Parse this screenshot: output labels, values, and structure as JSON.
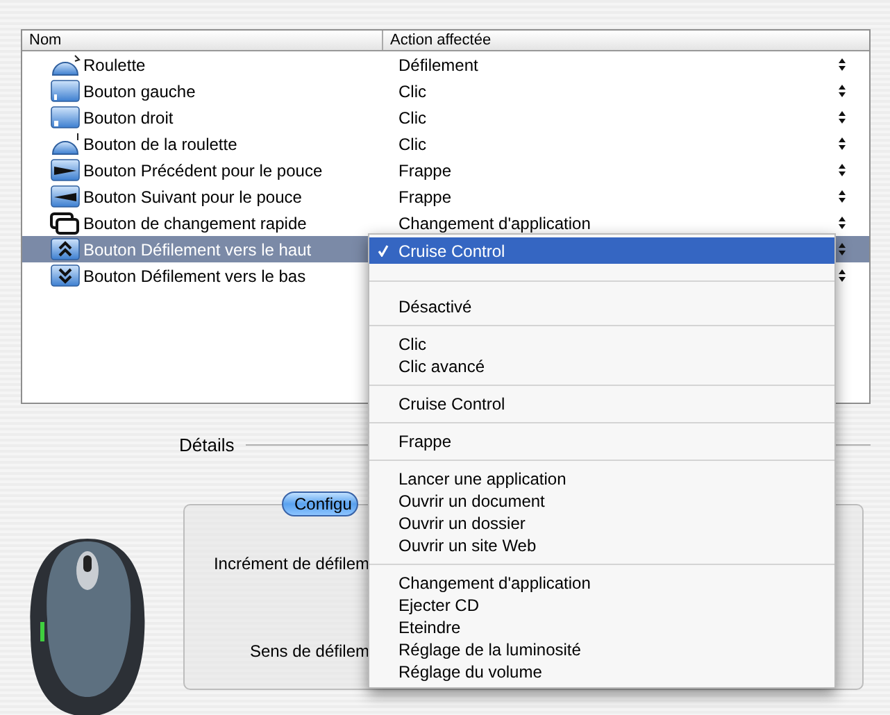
{
  "table": {
    "columns": [
      "Nom",
      "Action affectée"
    ],
    "rows": [
      {
        "kind": "wheel",
        "name": "Roulette",
        "action": "Défilement",
        "selected": false
      },
      {
        "kind": "button-left",
        "name": "Bouton gauche",
        "action": "Clic",
        "selected": false
      },
      {
        "kind": "button-right",
        "name": "Bouton droit",
        "action": "Clic",
        "selected": false
      },
      {
        "kind": "wheel-click",
        "name": "Bouton de la roulette",
        "action": "Clic",
        "selected": false
      },
      {
        "kind": "wedge-right",
        "name": "Bouton Précédent pour le pouce",
        "action": "Frappe",
        "selected": false
      },
      {
        "kind": "wedge-left",
        "name": "Bouton Suivant pour le pouce",
        "action": "Frappe",
        "selected": false
      },
      {
        "kind": "windows",
        "name": "Bouton de changement rapide",
        "action": "Changement d'application",
        "selected": false
      },
      {
        "kind": "chevrons-up",
        "name": "Bouton Défilement vers le haut",
        "selected": true
      },
      {
        "kind": "chevrons-down",
        "name": "Bouton Défilement vers le bas",
        "selected": false
      }
    ]
  },
  "menu": {
    "groups": [
      [
        {
          "label": "Cruise Control",
          "selected": true
        }
      ],
      [
        {
          "label": "Désactivé",
          "selected": false
        }
      ],
      [
        {
          "label": "Clic",
          "selected": false
        },
        {
          "label": "Clic avancé",
          "selected": false
        }
      ],
      [
        {
          "label": "Cruise Control",
          "selected": false
        }
      ],
      [
        {
          "label": "Frappe",
          "selected": false
        }
      ],
      [
        {
          "label": "Lancer une application",
          "selected": false
        },
        {
          "label": "Ouvrir un document",
          "selected": false
        },
        {
          "label": "Ouvrir un dossier",
          "selected": false
        },
        {
          "label": "Ouvrir un site Web",
          "selected": false
        }
      ],
      [
        {
          "label": "Changement d'application",
          "selected": false
        },
        {
          "label": "Ejecter CD",
          "selected": false
        },
        {
          "label": "Eteindre",
          "selected": false
        },
        {
          "label": "Réglage de la luminosité",
          "selected": false
        },
        {
          "label": "Réglage du volume",
          "selected": false
        }
      ]
    ]
  },
  "details": {
    "title": "Détails",
    "tab": "Configu",
    "scroll_increment_label": "Incrément de défilem",
    "direction_label": "Sens de défilem"
  }
}
